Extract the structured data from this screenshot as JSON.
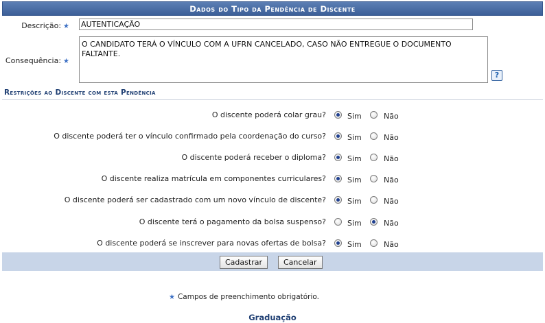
{
  "form": {
    "title": "Dados do Tipo da Pendência de Discente",
    "descricao_label": "Descrição:",
    "descricao_value": "AUTENTICAÇÃO",
    "consequencia_label": "Consequência:",
    "consequencia_value": "O CANDIDATO TERÁ O VÍNCULO COM A UFRN CANCELADO, CASO NÃO ENTREGUE O DOCUMENTO FALTANTE.",
    "help_icon": "?"
  },
  "restricoes": {
    "title": "Restrições ao Discente com esta Pendência",
    "sim_label": "Sim",
    "nao_label": "Não",
    "questions": [
      {
        "text": "O discente poderá colar grau?",
        "value": "Sim"
      },
      {
        "text": "O discente poderá ter o vínculo confirmado pela coordenação do curso?",
        "value": "Sim"
      },
      {
        "text": "O discente poderá receber o diploma?",
        "value": "Sim"
      },
      {
        "text": "O discente realiza matrícula em componentes curriculares?",
        "value": "Sim"
      },
      {
        "text": "O discente poderá ser cadastrado com um novo vínculo de discente?",
        "value": "Sim"
      },
      {
        "text": "O discente terá o pagamento da bolsa suspenso?",
        "value": "Não"
      },
      {
        "text": "O discente poderá se inscrever para novas ofertas de bolsa?",
        "value": "Sim"
      }
    ]
  },
  "buttons": {
    "cadastrar": "Cadastrar",
    "cancelar": "Cancelar"
  },
  "footer": {
    "required_note": "Campos de preenchimento obrigatório.",
    "required_symbol": "★",
    "link": "Graduação"
  },
  "colors": {
    "caption_bg": "#3c5f98",
    "footer_bar_bg": "#c8d5e8",
    "link": "#1f3f73"
  }
}
